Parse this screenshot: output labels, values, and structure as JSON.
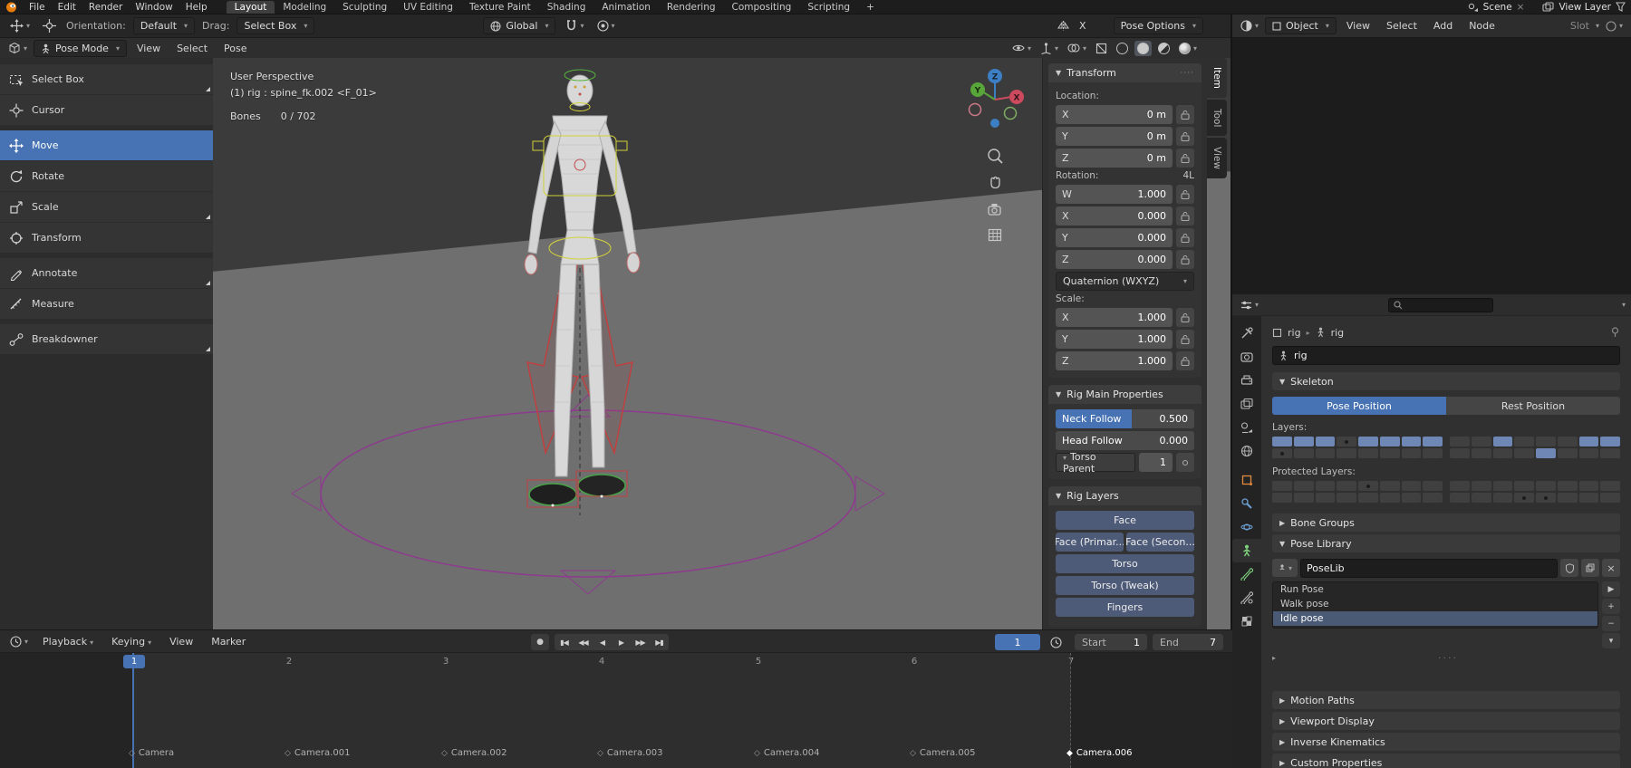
{
  "colors": {
    "accent": "#4772b3",
    "layer_on": "#6f87b5",
    "rig_button": "#4d5a78",
    "axis_x": "#cc4a5e",
    "axis_y": "#58a53a",
    "axis_z": "#3d7fc4"
  },
  "topbar": {
    "menus": [
      "File",
      "Edit",
      "Render",
      "Window",
      "Help"
    ],
    "workspaces": [
      "Layout",
      "Modeling",
      "Sculpting",
      "UV Editing",
      "Texture Paint",
      "Shading",
      "Animation",
      "Rendering",
      "Compositing",
      "Scripting"
    ],
    "active_workspace": "Layout",
    "new_workspace_label": "+",
    "scene_label": "Scene",
    "view_layer_label": "View Layer"
  },
  "tool_settings": {
    "orientation_label": "Orientation:",
    "orientation_value": "Default",
    "drag_label": "Drag:",
    "drag_value": "Select Box",
    "pivot_value": "Global",
    "mirror_label": "X",
    "pose_options_label": "Pose Options"
  },
  "viewport_header": {
    "mode_value": "Pose Mode",
    "menus": [
      "View",
      "Select",
      "Pose"
    ]
  },
  "toolbar": {
    "active_tool": "Move",
    "tools": [
      {
        "label": "Select Box"
      },
      {
        "label": "Cursor"
      },
      {
        "label": "Move"
      },
      {
        "label": "Rotate"
      },
      {
        "label": "Scale"
      },
      {
        "label": "Transform"
      },
      {
        "label": "Annotate"
      },
      {
        "label": "Measure"
      },
      {
        "label": "Breakdowner"
      }
    ]
  },
  "viewport": {
    "overlay_line1": "User Perspective",
    "overlay_line2": "(1) rig : spine_fk.002 <F_01>",
    "bones_label": "Bones",
    "bones_count": "0 / 702",
    "gizmo": {
      "x": "X",
      "y": "Y",
      "z": "Z"
    }
  },
  "sidebar_tabs": {
    "active": "Item",
    "items": [
      "Item",
      "Tool",
      "View"
    ]
  },
  "npanel": {
    "transform": {
      "title": "Transform",
      "location_label": "Location:",
      "rows_location": [
        {
          "axis": "X",
          "value": "0 m"
        },
        {
          "axis": "Y",
          "value": "0 m"
        },
        {
          "axis": "Z",
          "value": "0 m"
        }
      ],
      "rotation_label": "Rotation:",
      "rotation_badge": "4L",
      "rows_rotation": [
        {
          "axis": "W",
          "value": "1.000"
        },
        {
          "axis": "X",
          "value": "0.000"
        },
        {
          "axis": "Y",
          "value": "0.000"
        },
        {
          "axis": "Z",
          "value": "0.000"
        }
      ],
      "rotation_mode": "Quaternion (WXYZ)",
      "scale_label": "Scale:",
      "rows_scale": [
        {
          "axis": "X",
          "value": "1.000"
        },
        {
          "axis": "Y",
          "value": "1.000"
        },
        {
          "axis": "Z",
          "value": "1.000"
        }
      ]
    },
    "rig_main": {
      "title": "Rig Main Properties",
      "neck_follow_label": "Neck Follow",
      "neck_follow_value": "0.500",
      "head_follow_label": "Head Follow",
      "head_follow_value": "0.000",
      "torso_parent_label": "Torso Parent",
      "torso_parent_value": "1"
    },
    "rig_layers": {
      "title": "Rig Layers",
      "buttons": [
        "Face",
        "Face (Primar...",
        "Face (Secon...",
        "Torso",
        "Torso (Tweak)",
        "Fingers"
      ]
    }
  },
  "shader_editor": {
    "object_mode": "Object",
    "menus": [
      "View",
      "Select",
      "Add",
      "Node"
    ],
    "slot_label": "Slot"
  },
  "properties": {
    "breadcrumb_object": "rig",
    "breadcrumb_data": "rig",
    "name_value": "rig",
    "skeleton": {
      "title": "Skeleton",
      "pose_position": "Pose Position",
      "rest_position": "Rest Position",
      "layers_label": "Layers:",
      "protected_label": "Protected Layers:",
      "layers_left": [
        "on",
        "on",
        "on",
        "dot",
        "on",
        "on",
        "on",
        "on",
        "dot",
        "off",
        "off",
        "off",
        "off",
        "off",
        "off",
        "off"
      ],
      "layers_right": [
        "off",
        "off",
        "on",
        "off",
        "off",
        "off",
        "on",
        "on",
        "off",
        "off",
        "off",
        "off",
        "on",
        "off",
        "off",
        "off"
      ],
      "protected_left": [
        "off",
        "off",
        "off",
        "off",
        "dot",
        "off",
        "off",
        "off",
        "off",
        "off",
        "off",
        "off",
        "off",
        "off",
        "off",
        "off"
      ],
      "protected_right": [
        "off",
        "off",
        "off",
        "off",
        "off",
        "off",
        "off",
        "off",
        "off",
        "off",
        "off",
        "dot",
        "dot",
        "off",
        "off",
        "off"
      ]
    },
    "bone_groups_title": "Bone Groups",
    "pose_library": {
      "title": "Pose Library",
      "datablock": "PoseLib",
      "poses": [
        "Run Pose",
        "Walk pose",
        "Idle pose"
      ],
      "selected_pose": "Idle pose"
    },
    "collapsed_sections": [
      "Motion Paths",
      "Viewport Display",
      "Inverse Kinematics",
      "Custom Properties"
    ]
  },
  "timeline": {
    "menus": [
      "Playback",
      "Keying",
      "View",
      "Marker"
    ],
    "current_frame": "1",
    "start_label": "Start",
    "start_value": "1",
    "end_label": "End",
    "end_value": "7",
    "frames": [
      "1",
      "2",
      "3",
      "4",
      "5",
      "6",
      "7"
    ],
    "markers": [
      {
        "label": "Camera",
        "selected": false
      },
      {
        "label": "Camera.001",
        "selected": false
      },
      {
        "label": "Camera.002",
        "selected": false
      },
      {
        "label": "Camera.003",
        "selected": false
      },
      {
        "label": "Camera.004",
        "selected": false
      },
      {
        "label": "Camera.005",
        "selected": false
      },
      {
        "label": "Camera.006",
        "selected": true
      }
    ]
  }
}
